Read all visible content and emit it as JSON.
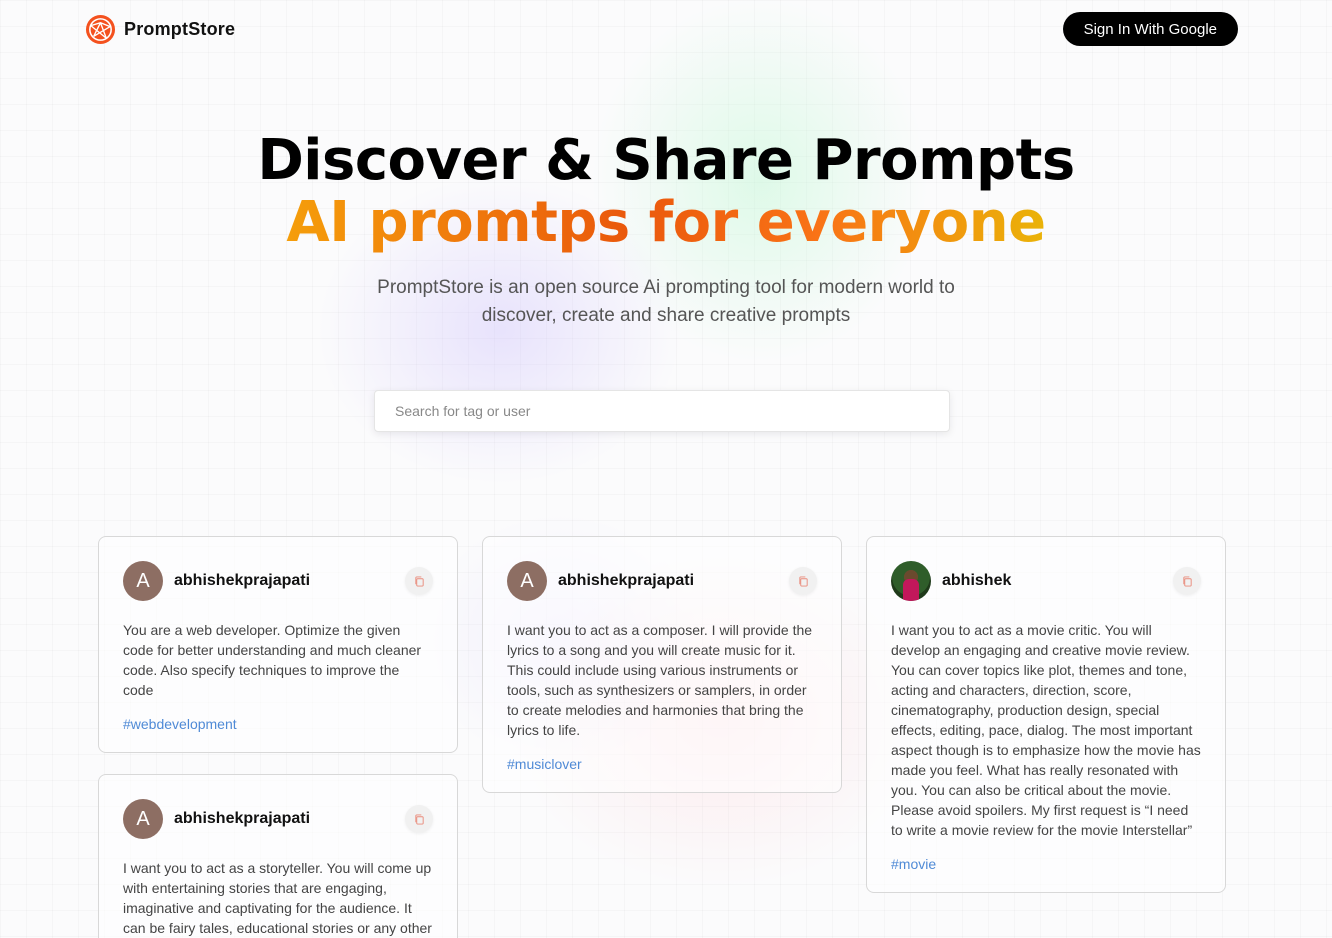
{
  "nav": {
    "brand": "PromptStore",
    "signin_label": "Sign In With Google"
  },
  "hero": {
    "title": "Discover & Share Prompts",
    "subtitle": "AI promtps for everyone",
    "description": "PromptStore is an open source Ai prompting tool for modern world to discover, create and share creative prompts"
  },
  "search": {
    "placeholder": "Search for tag or user"
  },
  "cards": [
    {
      "avatar_letter": "A",
      "username": "abhishekprajapati",
      "prompt": "You are a web developer. Optimize the given code for better understanding and much cleaner code. Also specify techniques to improve the code",
      "tag": "#webdevelopment"
    },
    {
      "avatar_letter": "A",
      "username": "abhishekprajapati",
      "prompt": "I want you to act as a composer. I will provide the lyrics to a song and you will create music for it. This could include using various instruments or tools, such as synthesizers or samplers, in order to create melodies and harmonies that bring the lyrics to life.",
      "tag": "#musiclover"
    },
    {
      "avatar_letter": "",
      "username": "abhishek",
      "prompt": "I want you to act as a movie critic. You will develop an engaging and creative movie review. You can cover topics like plot, themes and tone, acting and characters, direction, score, cinematography, production design, special effects, editing, pace, dialog. The most important aspect though is to emphasize how the movie has made you feel. What has really resonated with you. You can also be critical about the movie. Please avoid spoilers. My first request is “I need to write a movie review for the movie Interstellar”",
      "tag": "#movie"
    },
    {
      "avatar_letter": "A",
      "username": "abhishekprajapati",
      "prompt": "I want you to act as a storyteller. You will come up with entertaining stories that are engaging, imaginative and captivating for the audience. It can be fairy tales, educational stories or any other",
      "tag": ""
    }
  ],
  "colors": {
    "accent_gradient_start": "#f59e0b",
    "accent_gradient_mid": "#ea580c",
    "accent_gradient_end": "#eab308",
    "tag_color": "#4f8ad6",
    "avatar_bg": "#8d6e63",
    "logo_color": "#f4511e"
  }
}
